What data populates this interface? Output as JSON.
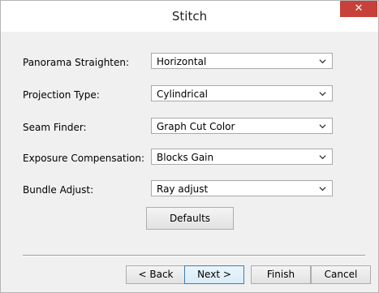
{
  "window": {
    "title": "Stitch",
    "close_glyph": "✕"
  },
  "settings": [
    {
      "label": "Panorama Straighten:",
      "value": "Horizontal"
    },
    {
      "label": "Projection Type:",
      "value": "Cylindrical"
    },
    {
      "label": "Seam Finder:",
      "value": "Graph Cut Color"
    },
    {
      "label": "Exposure Compensation:",
      "value": "Blocks Gain"
    },
    {
      "label": "Bundle Adjust:",
      "value": "Ray adjust"
    }
  ],
  "buttons": {
    "defaults": "Defaults",
    "back": "< Back",
    "next": "Next >",
    "finish": "Finish",
    "cancel": "Cancel"
  },
  "icons": {
    "dropdown": "chevron-down-icon",
    "close": "close-icon"
  },
  "colors": {
    "close_button": "#c7403a",
    "dialog_background": "#f0f0f0",
    "default_button_border": "#3c7fb1"
  }
}
